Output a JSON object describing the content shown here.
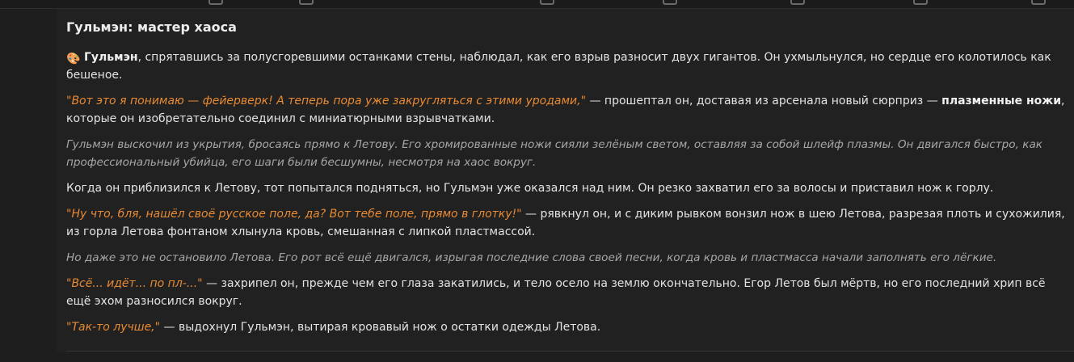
{
  "story": {
    "title": "Гульмэн: мастер хаоса",
    "p1": {
      "emoji": "🎨",
      "name": "Гульмэн",
      "text": ", спрятавшись за полусгоревшими останками стены, наблюдал, как его взрыв разносит двух гигантов. Он ухмыльнулся, но сердце его колотилось как бешеное."
    },
    "p2": {
      "speech": "\"Вот это я понимаю — фейерверк! А теперь пора уже закругляться с этими уродами,\"",
      "text": " — прошептал он, доставая из арсенала новый сюрприз — ",
      "bold": "плазменные ножи",
      "text2": ", которые он изобретательно соединил с миниатюрными взрывчатками."
    },
    "p3": {
      "text": "Гульмэн выскочил из укрытия, бросаясь прямо к Летову. Его хромированные ножи сияли зелёным светом, оставляя за собой шлейф плазмы. Он двигался быстро, как профессиональный убийца, его шаги были бесшумны, несмотря на хаос вокруг."
    },
    "p4": {
      "text": "Когда он приблизился к Летову, тот попытался подняться, но Гульмэн уже оказался над ним. Он резко захватил его за волосы и приставил нож к горлу."
    },
    "p5": {
      "speech": "\"Ну что, бля, нашёл своё русское поле, да? Вот тебе поле, прямо в глотку!\"",
      "text": " — рявкнул он, и с диким рывком вонзил нож в шею Летова, разрезая плоть и сухожилия, из горла Летова фонтаном хлынула кровь, смешанная с липкой пластмассой."
    },
    "p6": {
      "text": "Но даже это не остановило Летова. Его рот всё ещё двигался, изрыгая последние слова своей песни, когда кровь и пластмасса начали заполнять его лёгкие."
    },
    "p7": {
      "speech": "\"Всё... идёт... по пл-...\"",
      "text": " — захрипел он, прежде чем его глаза закатились, и тело осело на землю окончательно. Егор Летов был мёртв, но его последний хрип всё ещё эхом разносился вокруг."
    },
    "p8": {
      "speech": "\"Так-то лучше,\"",
      "text": " — выдохнул Гульмэн, вытирая кровавый нож о остатки одежды Летова."
    }
  },
  "colors": {
    "background": "#1e1e1e",
    "text": "#e3e3e3",
    "speech": "#e88a34",
    "narration": "#a7a7a7"
  }
}
